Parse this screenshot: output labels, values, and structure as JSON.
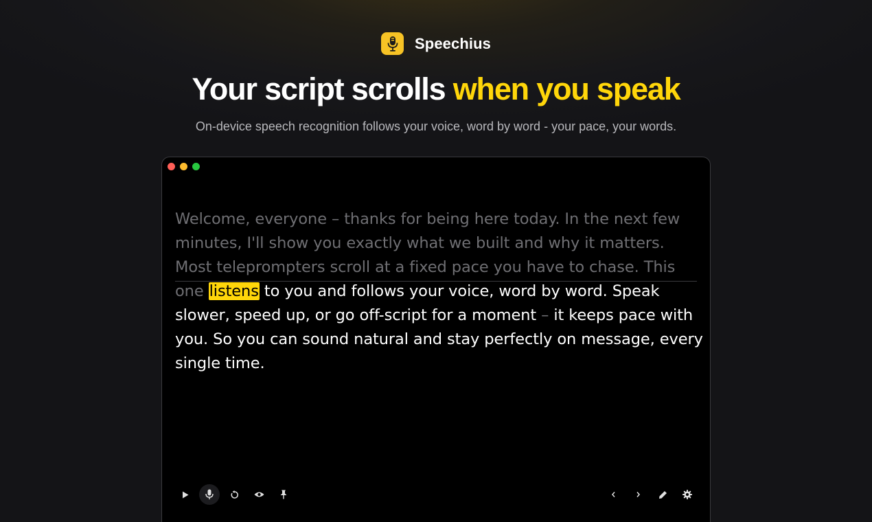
{
  "brand": {
    "name": "Speechius",
    "logo_icon": "microphone-icon",
    "accent": "#f7c325"
  },
  "hero": {
    "title_part1": "Your script scrolls",
    "title_part2": "when you speak",
    "subtitle": "On-device speech recognition follows your voice, word by word - your pace, your words."
  },
  "window": {
    "controls": [
      "close",
      "minimize",
      "zoom"
    ],
    "script": {
      "read_text": "Welcome, everyone – thanks for being here today. In the next few minutes, I'll show you exactly what we built and why it matters. Most teleprompters scroll at a fixed pace you have to chase. This one",
      "current_word": "listens",
      "upcoming_text_1": "to you and follows your voice, word by word. Speak slower, speed up, or go off-script for a moment",
      "upcoming_dash": "–",
      "upcoming_text_2": "it keeps pace with you. So you can sound natural and stay perfectly on message, every single time."
    }
  },
  "toolbar": {
    "left": [
      "play-icon",
      "microphone-icon",
      "restart-icon",
      "eye-icon",
      "pin-icon"
    ],
    "right": [
      "chevron-left-icon",
      "chevron-right-icon",
      "pencil-icon",
      "gear-icon"
    ],
    "highlight_color": "#ffd60a"
  }
}
